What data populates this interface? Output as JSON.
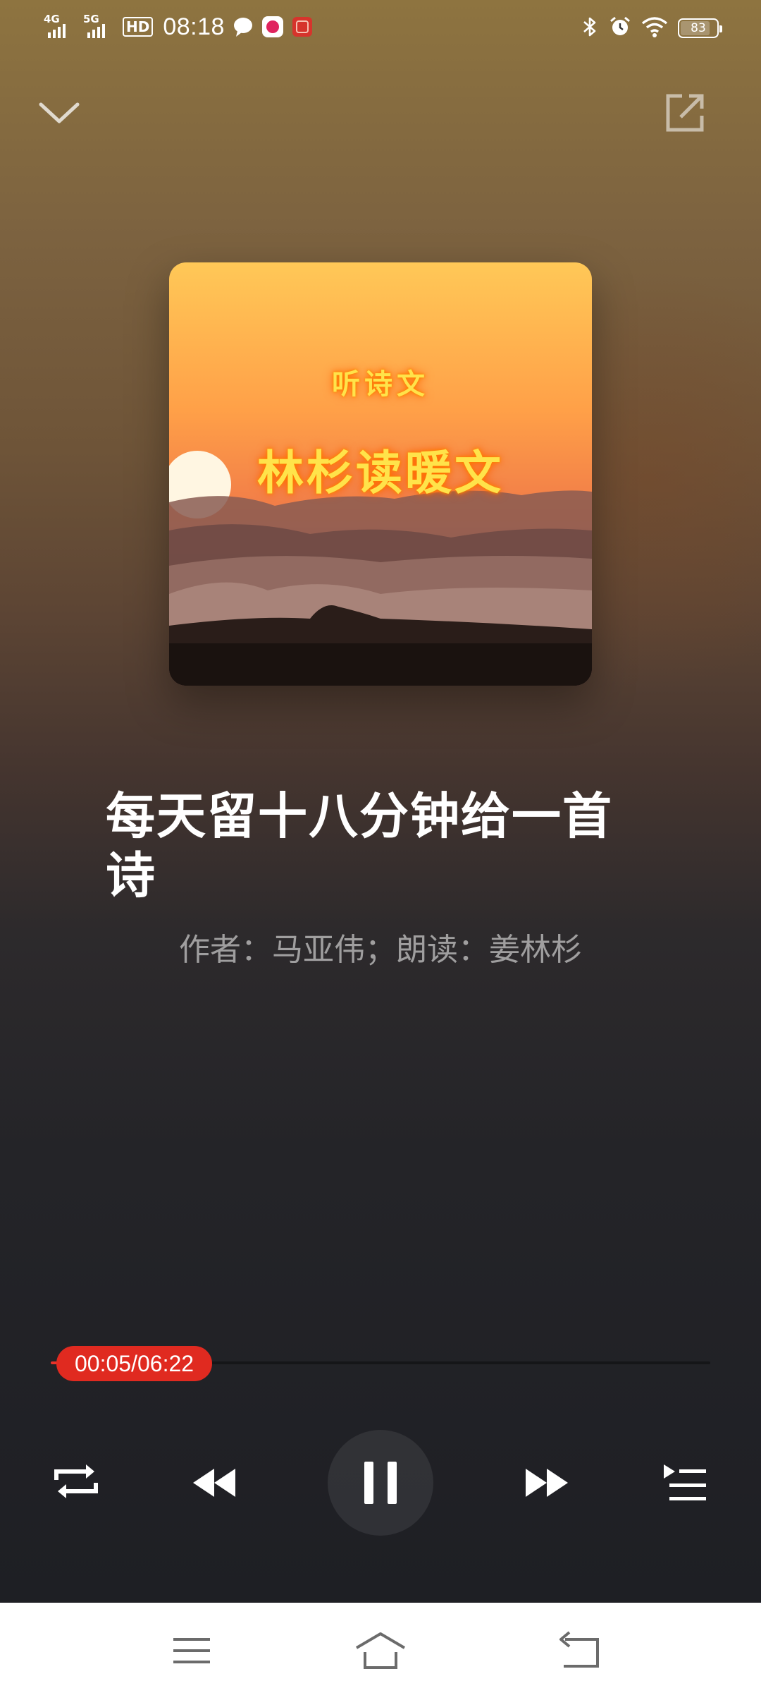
{
  "status_bar": {
    "network_1": "4G",
    "network_2": "5G",
    "hd_label": "HD",
    "time": "08:18",
    "battery": "83",
    "battery_level": 0.83
  },
  "cover": {
    "subtitle": "听诗文",
    "title": "林杉读暖文"
  },
  "song": {
    "title": "每天留十八分钟给一首诗",
    "meta": "作者：马亚伟；朗读：姜林杉"
  },
  "progress": {
    "label": "00:05/06:22",
    "elapsed": "00:05",
    "duration": "06:22",
    "fraction": 0.013
  },
  "colors": {
    "accent": "#e02a20"
  },
  "icons": {
    "collapse": "chevron-down-icon",
    "share": "share-icon",
    "repeat": "repeat-icon",
    "previous": "rewind-icon",
    "pause": "pause-icon",
    "next": "fast-forward-icon",
    "playlist": "playlist-icon",
    "nav_menu": "menu-icon",
    "nav_home": "home-icon",
    "nav_back": "back-icon"
  }
}
